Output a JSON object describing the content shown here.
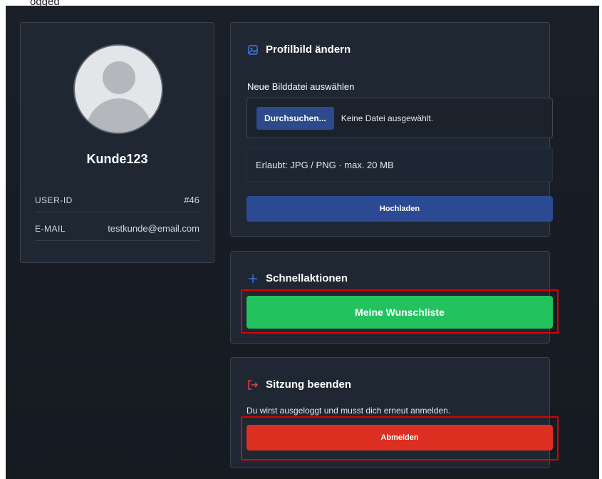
{
  "top_text": "ogged",
  "profile": {
    "username": "Kunde123",
    "rows": [
      {
        "label": "USER-ID",
        "value": "#46"
      },
      {
        "label": "E-MAIL",
        "value": "testkunde@email.com"
      }
    ]
  },
  "upload": {
    "title": "Profilbild ändern",
    "icon": "image-icon",
    "field_label": "Neue Bilddatei auswählen",
    "browse_label": "Durchsuchen...",
    "file_status": "Keine Datei ausgewählt.",
    "allowed": "Erlaubt: JPG / PNG · max. 20 MB",
    "submit_label": "Hochladen"
  },
  "quick": {
    "title": "Schnellaktionen",
    "icon": "plus-icon",
    "wishlist_label": "Meine Wunschliste"
  },
  "session": {
    "title": "Sitzung beenden",
    "icon": "logout-icon",
    "description": "Du wirst ausgeloggt und musst dich erneut anmelden.",
    "logout_label": "Abmelden"
  },
  "colors": {
    "accent_blue": "#2c4a93",
    "success_green": "#22c35e",
    "danger_red": "#dc2f22",
    "highlight_red": "#e00000"
  }
}
